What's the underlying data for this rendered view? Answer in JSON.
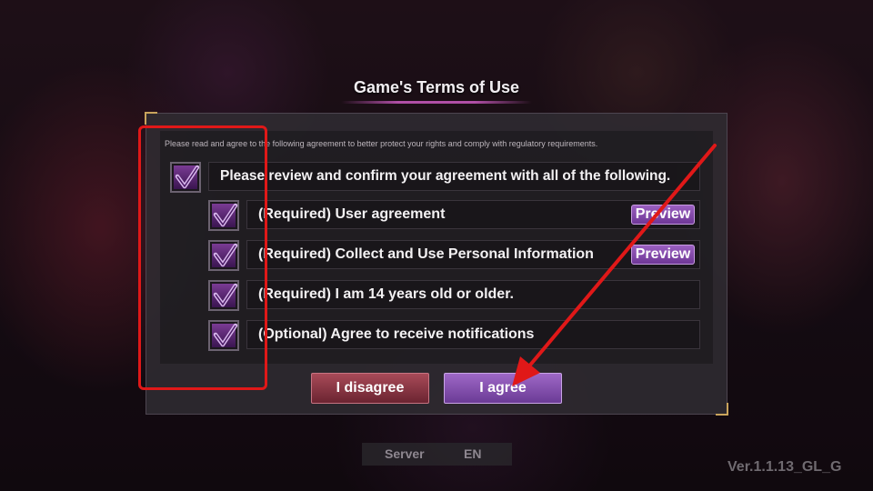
{
  "dialog": {
    "title": "Game's Terms of Use",
    "intro": "Please read and agree to the following agreement to better protect your rights and comply with regulatory requirements.",
    "agree_all": {
      "label": "Please review and confirm your agreement with all of the following.",
      "checked": true
    },
    "items": [
      {
        "label": "(Required) User agreement",
        "checked": true,
        "preview_label": "Preview"
      },
      {
        "label": "(Required) Collect and Use Personal Information",
        "checked": true,
        "preview_label": "Preview"
      },
      {
        "label": "(Required) I am 14 years old or older.",
        "checked": true
      },
      {
        "label": "(Optional) Agree to receive notifications",
        "checked": true
      }
    ],
    "disagree_label": "I disagree",
    "agree_label": "I agree"
  },
  "footer": {
    "server_label": "Server",
    "server_value": "EN",
    "version": "Ver.1.1.13_GL_G"
  },
  "colors": {
    "accent_purple": "#7a3b94",
    "disagree_red": "#a84a58",
    "annotation_red": "#e01818"
  },
  "icons": {
    "checkbox": "check-icon",
    "annotation_arrow": "arrow-icon"
  }
}
